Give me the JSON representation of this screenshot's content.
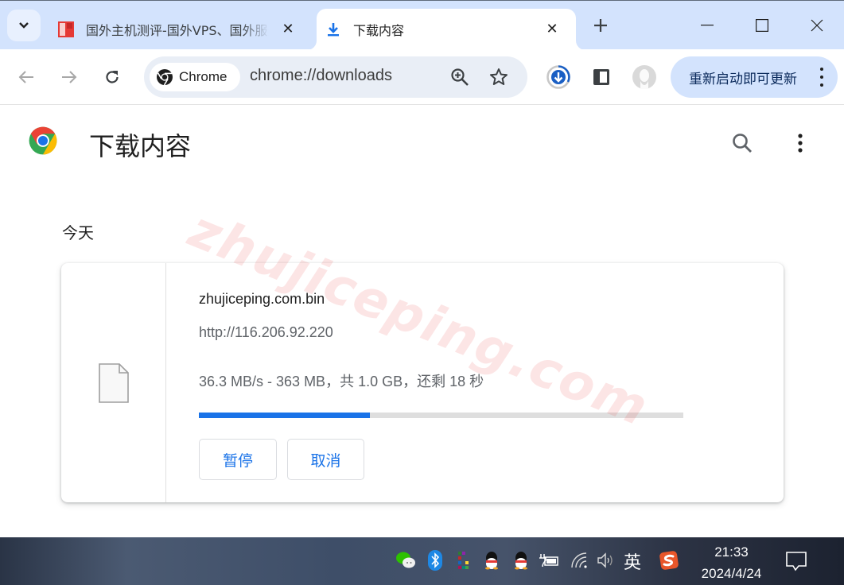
{
  "browser": {
    "tabs": [
      {
        "title": "国外主机测评-国外VPS、国外服务器",
        "active": false,
        "favicon": "site-logo-icon"
      },
      {
        "title": "下载内容",
        "active": true,
        "favicon": "download-icon"
      }
    ],
    "omnibox": {
      "chip_label": "Chrome",
      "url": "chrome://downloads"
    },
    "update_button_label": "重新启动即可更新",
    "accent_color": "#1a73e8"
  },
  "page": {
    "title": "下载内容",
    "section_date": "今天",
    "download": {
      "file_name": "zhujiceping.com.bin",
      "source_url": "http://116.206.92.220",
      "status": "36.3 MB/s - 363 MB，共 1.0 GB，还剩 18 秒",
      "progress_percent": 35.3,
      "pause_label": "暂停",
      "cancel_label": "取消"
    },
    "watermark": "zhujiceping.com"
  },
  "taskbar": {
    "tray_icons": [
      "wechat-icon",
      "bluetooth-icon",
      "app-grid-icon",
      "qq-icon",
      "qq-icon",
      "battery-icon",
      "wifi-icon",
      "volume-icon"
    ],
    "ime_label": "英",
    "time": "21:33",
    "date": "2024/4/24"
  }
}
